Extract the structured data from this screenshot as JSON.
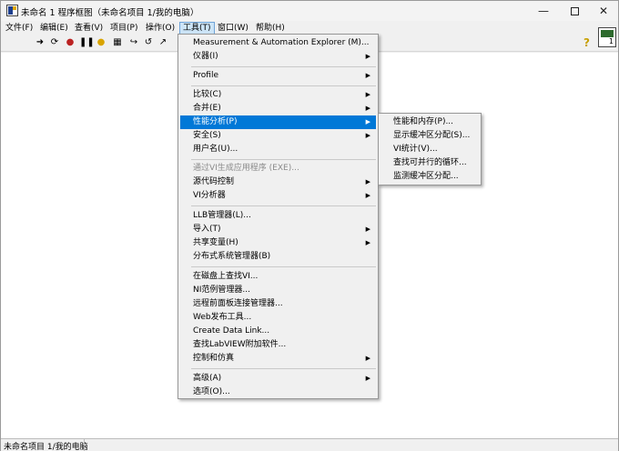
{
  "window": {
    "title": "未命名 1 程序框图（未命名项目 1/我的电脑）",
    "minimize_icon": "minimize-icon",
    "maximize_icon": "maximize-icon",
    "close_icon": "close-icon"
  },
  "menubar": {
    "items": [
      {
        "label": "文件(F)"
      },
      {
        "label": "编辑(E)"
      },
      {
        "label": "查看(V)"
      },
      {
        "label": "项目(P)"
      },
      {
        "label": "操作(O)"
      },
      {
        "label": "工具(T)"
      },
      {
        "label": "窗口(W)"
      },
      {
        "label": "帮助(H)"
      }
    ]
  },
  "tools_menu": {
    "items": [
      {
        "label": "Measurement & Automation Explorer (M)..."
      },
      {
        "label": "仪器(I)"
      },
      {
        "label": "Profile"
      },
      {
        "label": "比较(C)"
      },
      {
        "label": "合并(E)"
      },
      {
        "label": "性能分析(P)"
      },
      {
        "label": "安全(S)"
      },
      {
        "label": "用户名(U)..."
      },
      {
        "label": "通过VI生成应用程序 (EXE)..."
      },
      {
        "label": "源代码控制"
      },
      {
        "label": "VI分析器"
      },
      {
        "label": "LLB管理器(L)..."
      },
      {
        "label": "导入(T)"
      },
      {
        "label": "共享变量(H)"
      },
      {
        "label": "分布式系统管理器(B)"
      },
      {
        "label": "在磁盘上查找VI..."
      },
      {
        "label": "NI范例管理器..."
      },
      {
        "label": "远程前面板连接管理器..."
      },
      {
        "label": "Web发布工具..."
      },
      {
        "label": "Create Data Link..."
      },
      {
        "label": "查找LabVIEW附加软件..."
      },
      {
        "label": "控制和仿真"
      },
      {
        "label": "高级(A)"
      },
      {
        "label": "选项(O)..."
      }
    ]
  },
  "performance_submenu": {
    "items": [
      {
        "label": "性能和内存(P)..."
      },
      {
        "label": "显示缓冲区分配(S)..."
      },
      {
        "label": "VI统计(V)..."
      },
      {
        "label": "查找可并行的循环..."
      },
      {
        "label": "监测缓冲区分配..."
      }
    ]
  },
  "toolbar": {
    "help_label": "?",
    "panel_number": "1"
  },
  "statusbar": {
    "text": "未命名项目 1/我的电脑"
  },
  "colors": {
    "selection": "#0078d7",
    "menubar_active": "#cce4f7"
  }
}
